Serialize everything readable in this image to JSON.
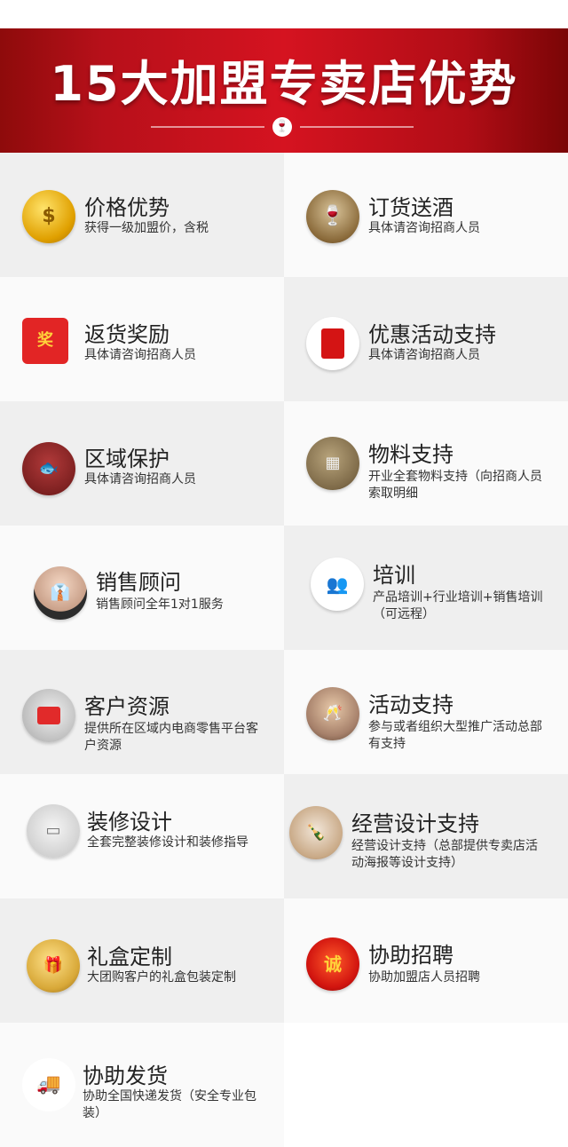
{
  "header": {
    "title": "15大加盟专卖店优势"
  },
  "advantages": [
    {
      "title": "价格优势",
      "desc": "获得一级加盟价，含税",
      "icon": "gold-coin-icon"
    },
    {
      "title": "订货送酒",
      "desc": "具体请咨询招商人员",
      "icon": "wine-bottle-icon"
    },
    {
      "title": "返货奖励",
      "desc": "具体请咨询招商人员",
      "icon": "gift-box-icon"
    },
    {
      "title": "优惠活动支持",
      "desc": "具体请咨询招商人员",
      "icon": "red-envelope-icon"
    },
    {
      "title": "区域保护",
      "desc": "具体请咨询招商人员",
      "icon": "koi-fish-icon"
    },
    {
      "title": "物料支持",
      "desc": "开业全套物料支持（向招商人员索取明细",
      "icon": "materials-icon"
    },
    {
      "title": "销售顾问",
      "desc": "销售顾问全年1对1服务",
      "icon": "consultant-icon"
    },
    {
      "title": "培训",
      "desc": "产品培训+行业培训+销售培训（可远程）",
      "icon": "training-icon"
    },
    {
      "title": "客户资源",
      "desc": "提供所在区域内电商零售平台客户资源",
      "icon": "shopping-cart-icon"
    },
    {
      "title": "活动支持",
      "desc": "参与或者组织大型推广活动总部有支持",
      "icon": "event-icon"
    },
    {
      "title": "装修设计",
      "desc": "全套完整装修设计和装修指导",
      "icon": "interior-design-icon"
    },
    {
      "title": "经营设计支持",
      "desc": "经营设计支持（总部提供专卖店活动海报等设计支持）",
      "icon": "business-design-icon"
    },
    {
      "title": "礼盒定制",
      "desc": "大团购客户的礼盒包装定制",
      "icon": "gift-package-icon"
    },
    {
      "title": "协助招聘",
      "desc": "协助加盟店人员招聘",
      "icon": "recruit-badge-icon"
    },
    {
      "title": "协助发货",
      "desc": "协助全国快递发货（安全专业包装）",
      "icon": "delivery-icon"
    }
  ],
  "icon_colors": {
    "banner_red": "#d51320"
  }
}
